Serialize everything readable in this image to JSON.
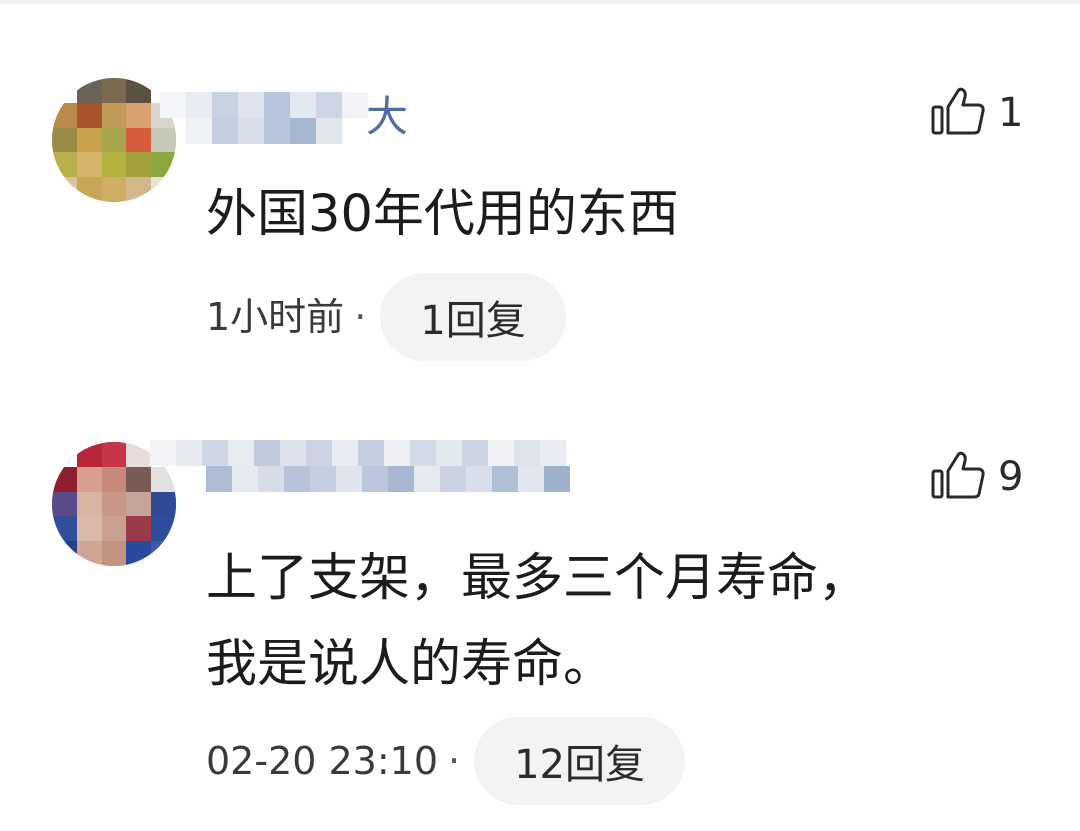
{
  "comments": [
    {
      "username": "大",
      "like_icon": "thumbs-up-outline-icon",
      "like_count": "1",
      "text": "外国30年代用的东西",
      "time": "1小时前",
      "separator": "·",
      "reply_label": "1回复"
    },
    {
      "username": "",
      "like_icon": "thumbs-up-outline-icon",
      "like_count": "9",
      "text": "上了支架，最多三个月寿命，\n我是说人的寿命。",
      "time": "02-20 23:10",
      "separator": "·",
      "reply_label": "12回复"
    }
  ],
  "colors": {
    "username": "#4d6fa3",
    "body_text": "#1c1c1c",
    "pill_bg": "#f2f3f5"
  }
}
